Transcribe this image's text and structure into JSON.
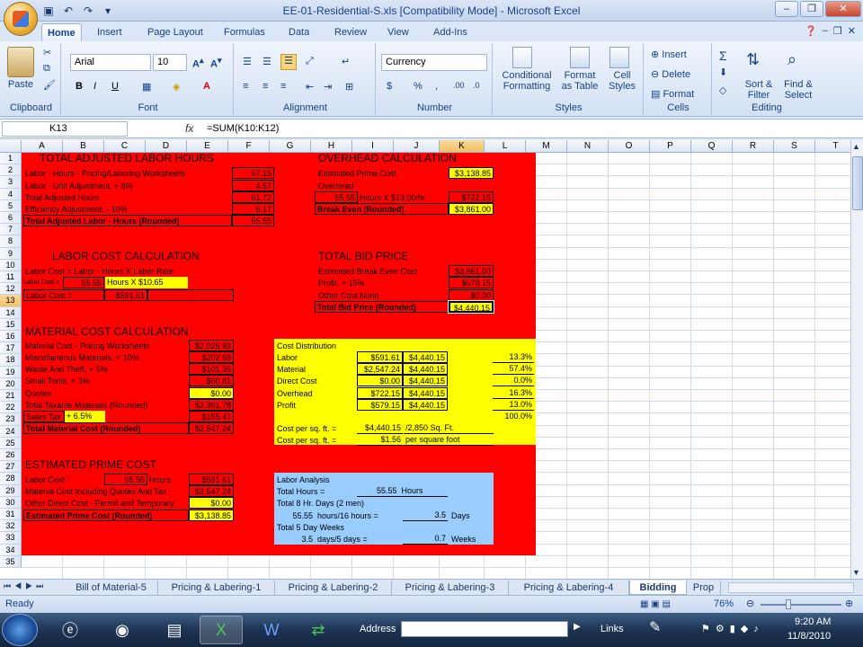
{
  "window": {
    "title": "EE-01-Residential-S.xls  [Compatibility Mode]  -  Microsoft Excel"
  },
  "ribbon_tabs": [
    "Home",
    "Insert",
    "Page Layout",
    "Formulas",
    "Data",
    "Review",
    "View",
    "Add-Ins"
  ],
  "ribbon": {
    "clipboard": {
      "paste": "Paste",
      "label": "Clipboard"
    },
    "font": {
      "name": "Arial",
      "size": "10",
      "label": "Font"
    },
    "alignment": {
      "label": "Alignment"
    },
    "number": {
      "format": "Currency",
      "label": "Number"
    },
    "styles": {
      "conditional": "Conditional",
      "formatting": "Formatting",
      "format_as": "Format",
      "as_table": "as Table",
      "cell": "Cell",
      "cell_styles": "Styles",
      "label": "Styles"
    },
    "cells": {
      "insert": "Insert",
      "delete": "Delete",
      "format": "Format",
      "label": "Cells"
    },
    "editing": {
      "sort": "Sort &",
      "filter": "Filter",
      "find": "Find &",
      "select": "Select",
      "label": "Editing"
    }
  },
  "formula_bar": {
    "cell": "K13",
    "fx": "fx",
    "formula": "=SUM(K10:K12)"
  },
  "columns": [
    "A",
    "B",
    "C",
    "D",
    "E",
    "F",
    "G",
    "H",
    "I",
    "J",
    "K",
    "L",
    "M",
    "N",
    "O",
    "P",
    "Q",
    "R",
    "S",
    "T"
  ],
  "rows": [
    "1",
    "2",
    "3",
    "4",
    "5",
    "6",
    "7",
    "8",
    "9",
    "10",
    "11",
    "12",
    "13",
    "14",
    "15",
    "16",
    "17",
    "18",
    "19",
    "20",
    "21",
    "22",
    "23",
    "24",
    "25",
    "26",
    "27",
    "28",
    "29",
    "30",
    "31",
    "32",
    "33",
    "34",
    "35"
  ],
  "labor_hours": {
    "title": "TOTAL ADJUSTED LABOR HOURS",
    "rows": [
      {
        "label": "Labor - Hours - Pricing/Laboring Worksheets",
        "value": "57.15"
      },
      {
        "label": "Labor - Unit Adjustment, + 8%",
        "value": "4.57"
      },
      {
        "label": "Total Adjusted Hours",
        "value": "61.72"
      },
      {
        "label": "Efficiency Adjustment, - 10%",
        "value": "6.17"
      },
      {
        "label": "Total Adjusted Labor - Hours (Rounded)",
        "value": "55.55"
      }
    ]
  },
  "overhead": {
    "title": "OVERHEAD CALCULATION",
    "prime_label": "Estimated Prime Cost",
    "prime_value": "$3,138.85",
    "overhead_label": "Overhead",
    "hours": "55.55",
    "rate_text": "Hours X $13.00/hr",
    "overhead_value": "$722.15",
    "breakeven_label": "Break Even (Rounded)",
    "breakeven_value": "$3,861.00"
  },
  "labor_cost": {
    "title": "LABOR COST CALCULATION",
    "formula_label": "Labor Cost = Labor - Hours X Labor Rate",
    "small_label": "Labor Cost =",
    "hours": "55.55",
    "rate": "Hours X $10.65",
    "cost_label": "Labor Cost =",
    "cost_value": "$591.61"
  },
  "total_bid": {
    "title": "TOTAL BID PRICE",
    "rows": [
      {
        "label": "Estimated Break Even Cost",
        "value": "$3,861.00"
      },
      {
        "label": "Profit, + 15%",
        "value": "$579.15"
      },
      {
        "label": "Other Cost  None",
        "value": "$0.00"
      }
    ],
    "total_label": "Total Bid Price (Rounded)",
    "total_value": "$4,440.15"
  },
  "material": {
    "title": "MATERIAL COST CALCULATION",
    "rows": [
      {
        "label": "Material Cost - Pricing Worksheets",
        "value": "$2,026.93"
      },
      {
        "label": "Miscellaneous Materials, + 10%",
        "value": "$202.69"
      },
      {
        "label": "Waste And Theft, + 5%",
        "value": "$101.35"
      },
      {
        "label": "Small Tools, + 3%",
        "value": "$60.81"
      },
      {
        "label": "Quotes",
        "value": "$0.00"
      },
      {
        "label": "Total Taxable Materials (Rounded)",
        "value": "$2,391.78"
      }
    ],
    "tax_label": "Sales Tax",
    "tax_rate": "+ 6.5%",
    "tax_value": "$155.47",
    "total_label": "Total Material Cost (Rounded)",
    "total_value": "$2,547.24"
  },
  "distribution": {
    "title": "Cost Distribution",
    "rows": [
      {
        "label": "Labor",
        "amount": "$591.61",
        "total": "$4,440.15",
        "pct": "13.3%"
      },
      {
        "label": "Material",
        "amount": "$2,547.24",
        "total": "$4,440.15",
        "pct": "57.4%"
      },
      {
        "label": "Direct Cost",
        "amount": "$0.00",
        "total": "$4,440.15",
        "pct": "0.0%"
      },
      {
        "label": "Overhead",
        "amount": "$722.15",
        "total": "$4,440.15",
        "pct": "16.3%"
      },
      {
        "label": "Profit",
        "amount": "$579.15",
        "total": "$4,440.15",
        "pct": "13.0%"
      }
    ],
    "pct_total": "100.0%",
    "sqft_label1": "Cost per sq. ft. =",
    "sqft_value1": "$4,440.15",
    "sqft_text1": "/2,850 Sq. Ft.",
    "sqft_label2": "Cost per sq. ft. =",
    "sqft_value2": "$1.56",
    "sqft_text2": "per square foot"
  },
  "prime_cost": {
    "title": "ESTIMATED PRIME COST",
    "labor_label": "Labor Cost -",
    "labor_hours": "55.55",
    "hours_word": "Hours",
    "labor_value": "$591.61",
    "material_label": "Material Cost Including Quotes And Tax",
    "material_value": "$2,547.24",
    "other_label": "Other Direct Cost - Permit and Temporary",
    "other_value": "$0.00",
    "total_label": "Estimated Prime Cost (Rounded)",
    "total_value": "$3,138.85"
  },
  "labor_analysis": {
    "title": "Labor Analysis",
    "total_hours_label": "Total Hours =",
    "total_hours": "55.55",
    "hours_word": "Hours",
    "days_label": "Total 8 Hr. Days (2 men)",
    "days_calc_hours": "55.55",
    "days_calc_text": "hours/16 hours =",
    "days_value": "3.5",
    "days_word": "Days",
    "weeks_label": "Total 5 Day Weeks",
    "weeks_calc_days": "3.5",
    "weeks_calc_text": "days/5 days =",
    "weeks_value": "0.7",
    "weeks_word": "Weeks"
  },
  "sheet_tabs": [
    "Bill of Material-5",
    "Pricing & Labering-1",
    "Pricing & Labering-2",
    "Pricing & Labering-3",
    "Pricing & Labering-4",
    "Bidding",
    "Prop"
  ],
  "status": {
    "ready": "Ready",
    "zoom": "76%"
  },
  "taskbar": {
    "address_label": "Address",
    "links_label": "Links",
    "time": "9:20 AM",
    "date": "11/8/2010"
  },
  "colors": {
    "red": "#ff0000",
    "yellow": "#ffff00",
    "blue": "#99ccff"
  }
}
